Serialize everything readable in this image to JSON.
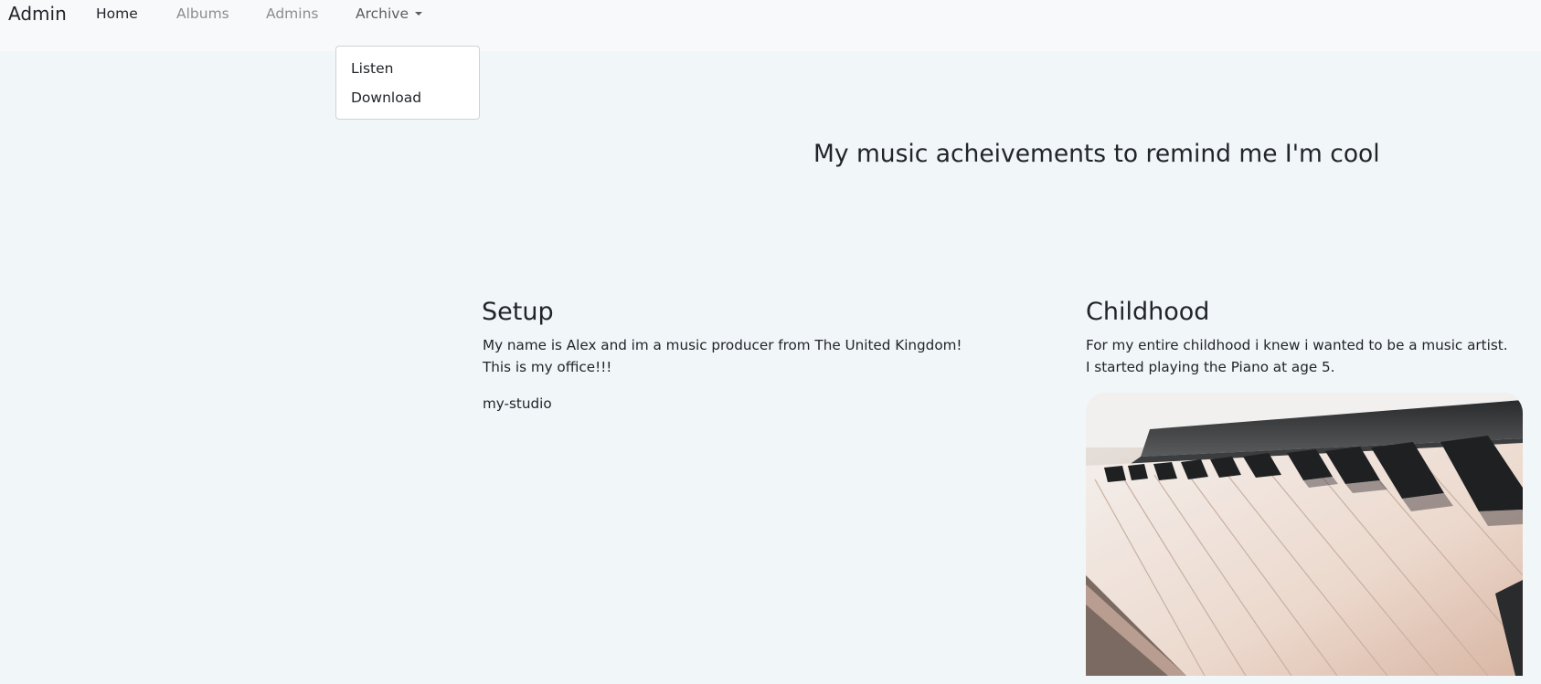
{
  "navbar": {
    "brand": "Admin",
    "links": [
      {
        "label": "Home",
        "active": true
      },
      {
        "label": "Albums",
        "active": false
      },
      {
        "label": "Admins",
        "active": false
      },
      {
        "label": "Archive",
        "active": false,
        "dropdown": true
      }
    ]
  },
  "dropdown": {
    "items": [
      "Listen",
      "Download"
    ]
  },
  "hero": {
    "title": "My music acheivements to remind me I'm cool"
  },
  "sections": {
    "setup": {
      "title": "Setup",
      "line1": "My name is Alex and im a music producer from The United Kingdom!",
      "line2": "This is my office!!!",
      "image_alt": "my-studio"
    },
    "childhood": {
      "title": "Childhood",
      "line1": "For my entire childhood i knew i wanted to be a music artist.",
      "line2": "I started playing the Piano at age 5."
    }
  },
  "colors": {
    "page_bg": "#f1f6f9",
    "navbar_bg": "#f8f9fb",
    "text": "#212529",
    "muted_link": "#8a8d90"
  }
}
